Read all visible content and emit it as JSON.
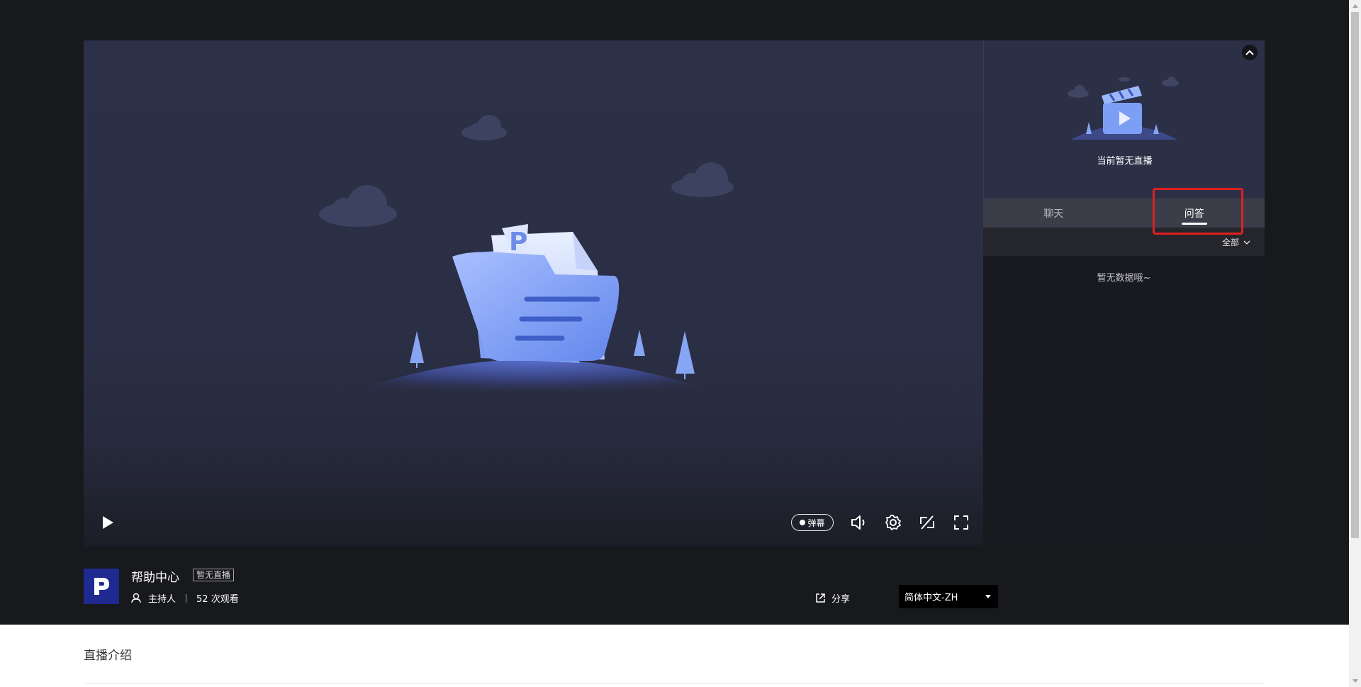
{
  "player": {
    "danmu_label": "弹幕",
    "icons": [
      "play-icon",
      "volume-icon",
      "settings-icon",
      "switch-icon",
      "fullscreen-icon"
    ]
  },
  "side_panel": {
    "no_live_text": "当前暂无直播",
    "tabs": [
      {
        "label": "聊天",
        "active": false
      },
      {
        "label": "问答",
        "active": true
      }
    ],
    "filter_label": "全部",
    "empty_text": "暂无数据哦~"
  },
  "channel": {
    "name": "帮助中心",
    "status_badge": "暂无直播",
    "host_label": "主持人",
    "views": "52 次观看",
    "share_label": "分享",
    "language": "简体中文-ZH"
  },
  "intro": {
    "title": "直播介绍"
  },
  "colors": {
    "page_bg": "#18191d",
    "player_bg": "#2c3048",
    "accent_blue": "#6b8ef2",
    "highlight": "#e02020"
  }
}
